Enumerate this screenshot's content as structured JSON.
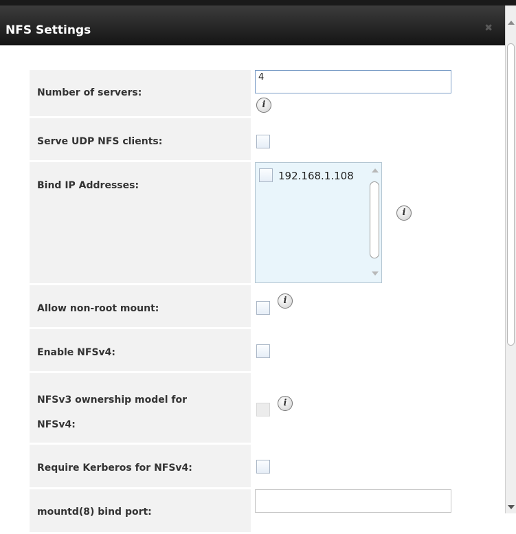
{
  "dialog": {
    "title": "NFS Settings",
    "close_icon": "close-icon"
  },
  "form": {
    "number_of_servers": {
      "label": "Number of servers:",
      "value": "4"
    },
    "serve_udp": {
      "label": "Serve UDP NFS clients:",
      "checked": false
    },
    "bind_ip": {
      "label": "Bind IP Addresses:",
      "options": [
        {
          "label": "192.168.1.108",
          "checked": false
        }
      ]
    },
    "allow_non_root": {
      "label": "Allow non-root mount:",
      "checked": false
    },
    "enable_nfsv4": {
      "label": "Enable NFSv4:",
      "checked": false
    },
    "nfsv3_ownership": {
      "label_line1": "NFSv3 ownership model for",
      "label_line2": "NFSv4:",
      "checked": false,
      "disabled": true
    },
    "require_kerberos": {
      "label": "Require Kerberos for NFSv4:",
      "checked": false
    },
    "mountd_port": {
      "label": "mountd(8) bind port:",
      "value": ""
    }
  },
  "icons": {
    "info": "info-icon",
    "info_glyph": "i"
  }
}
